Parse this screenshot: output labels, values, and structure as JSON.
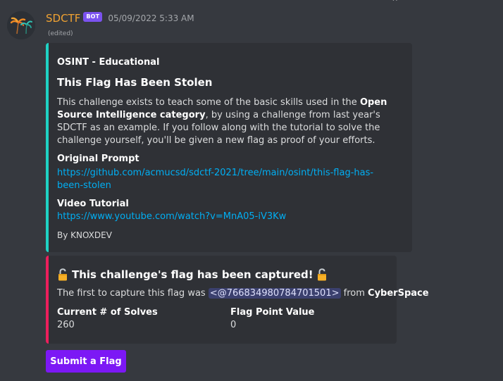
{
  "message": {
    "username": "SDCTF",
    "bot_tag": "BOT",
    "timestamp": "05/09/2022 5:33 AM",
    "edited": "(edited)",
    "avatar_icon": "palm-trees-icon"
  },
  "embed1": {
    "accent_color": "#1fd2c4",
    "author": "OSINT - Educational",
    "title": "This Flag Has Been Stolen",
    "desc_part1": "This challenge exists to teach some of the basic skills used in the ",
    "desc_bold": "Open Source Intelligence category",
    "desc_part2": ", by using a challenge from last year's SDCTF as an example. If you follow along with the tutorial to solve the challenge yourself, you'll be given a new flag as proof of your efforts.",
    "field1_name": "Original Prompt",
    "field1_value": "https://github.com/acmucsd/sdctf-2021/tree/main/osint/this-flag-has-been-stolen",
    "field2_name": "Video Tutorial",
    "field2_value": "https://www.youtube.com/watch?v=MnA05-iV3Kw",
    "footer": "By KNOXDEV"
  },
  "embed2": {
    "accent_color": "#ed1f5c",
    "title": "This challenge's flag has been captured!",
    "lock_icon": "unlocked-padlock-icon",
    "desc_prefix": "The first to capture this flag was ",
    "mention": "<@766834980784701501>",
    "desc_mid": " from ",
    "team": "CyberSpace",
    "field_a_name": "Current # of Solves",
    "field_a_value": "260",
    "field_b_name": "Flag Point Value",
    "field_b_value": "0"
  },
  "button": {
    "label": "Submit a Flag",
    "color": "#7c18f5"
  }
}
